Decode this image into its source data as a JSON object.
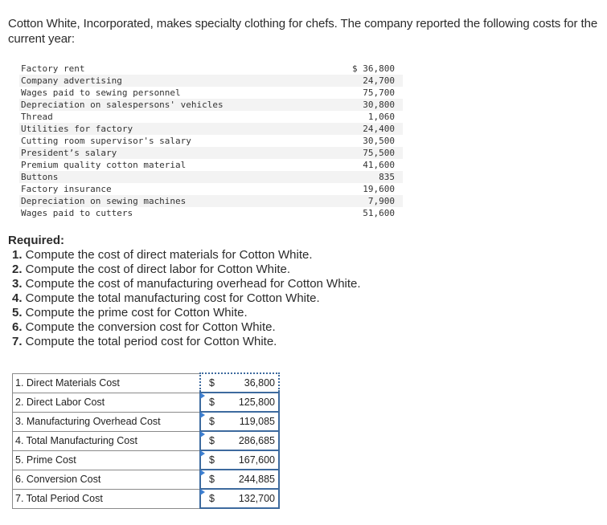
{
  "intro": {
    "text": "Cotton White, Incorporated, makes specialty clothing for chefs. The company reported the following costs for the current year:"
  },
  "costs": [
    {
      "item": "Factory rent",
      "amount": "$ 36,800"
    },
    {
      "item": "Company advertising",
      "amount": "24,700"
    },
    {
      "item": "Wages paid to sewing personnel",
      "amount": "75,700"
    },
    {
      "item": "Depreciation on salespersons' vehicles",
      "amount": "30,800"
    },
    {
      "item": "Thread",
      "amount": "1,060"
    },
    {
      "item": "Utilities for factory",
      "amount": "24,400"
    },
    {
      "item": "Cutting room supervisor's salary",
      "amount": "30,500"
    },
    {
      "item": "President’s salary",
      "amount": "75,500"
    },
    {
      "item": "Premium quality cotton material",
      "amount": "41,600"
    },
    {
      "item": "Buttons",
      "amount": "835"
    },
    {
      "item": "Factory insurance",
      "amount": "19,600"
    },
    {
      "item": "Depreciation on sewing machines",
      "amount": "7,900"
    },
    {
      "item": "Wages paid to cutters",
      "amount": "51,600"
    }
  ],
  "required": {
    "heading": "Required:",
    "items": [
      {
        "num": "1.",
        "text": " Compute the cost of direct materials for Cotton White."
      },
      {
        "num": "2.",
        "text": " Compute the cost of direct labor for Cotton White."
      },
      {
        "num": "3.",
        "text": " Compute the cost of manufacturing overhead for Cotton White."
      },
      {
        "num": "4.",
        "text": " Compute the total manufacturing cost for Cotton White."
      },
      {
        "num": "5.",
        "text": " Compute the prime cost for Cotton White."
      },
      {
        "num": "6.",
        "text": " Compute the conversion cost for Cotton White."
      },
      {
        "num": "7.",
        "text": " Compute the total period cost for Cotton White."
      }
    ]
  },
  "answers": [
    {
      "label": "1. Direct Materials Cost",
      "currency": "$",
      "value": "36,800"
    },
    {
      "label": "2. Direct Labor Cost",
      "currency": "$",
      "value": "125,800"
    },
    {
      "label": "3. Manufacturing Overhead Cost",
      "currency": "$",
      "value": "119,085"
    },
    {
      "label": "4. Total Manufacturing Cost",
      "currency": "$",
      "value": "286,685"
    },
    {
      "label": "5. Prime Cost",
      "currency": "$",
      "value": "167,600"
    },
    {
      "label": "6. Conversion Cost",
      "currency": "$",
      "value": "244,885"
    },
    {
      "label": "7. Total Period Cost",
      "currency": "$",
      "value": "132,700"
    }
  ],
  "colors": {
    "input_border": "#3d6a9e",
    "flag": "#3d7fd1",
    "stripe": "#f3f3f3"
  }
}
